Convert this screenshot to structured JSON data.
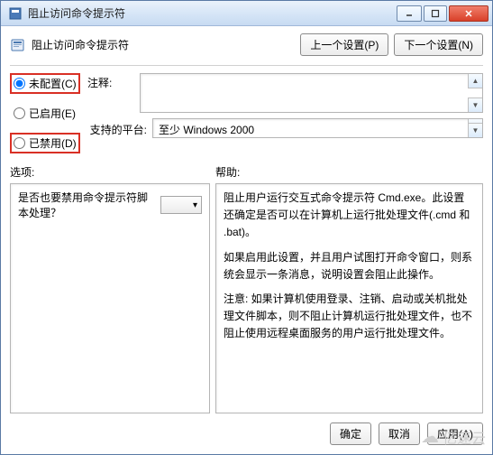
{
  "window": {
    "title": "阻止访问命令提示符"
  },
  "header": {
    "title": "阻止访问命令提示符",
    "prev_btn": "上一个设置(P)",
    "next_btn": "下一个设置(N)"
  },
  "radios": {
    "not_configured": "未配置(C)",
    "enabled": "已启用(E)",
    "disabled": "已禁用(D)"
  },
  "fields": {
    "comment_label": "注释:",
    "platform_label": "支持的平台:",
    "platform_value": "至少 Windows 2000"
  },
  "sections": {
    "options_label": "选项:",
    "help_label": "帮助:"
  },
  "options": {
    "question": "是否也要禁用命令提示符脚本处理？"
  },
  "help": {
    "p1": "阻止用户运行交互式命令提示符 Cmd.exe。此设置还确定是否可以在计算机上运行批处理文件(.cmd 和 .bat)。",
    "p2": "如果启用此设置，并且用户试图打开命令窗口，则系统会显示一条消息，说明设置会阻止此操作。",
    "p3": "注意: 如果计算机使用登录、注销、启动或关机批处理文件脚本，则不阻止计算机运行批处理文件，也不阻止使用远程桌面服务的用户运行批处理文件。"
  },
  "footer": {
    "ok": "确定",
    "cancel": "取消",
    "apply": "应用(A)"
  },
  "watermark": "亿速云"
}
